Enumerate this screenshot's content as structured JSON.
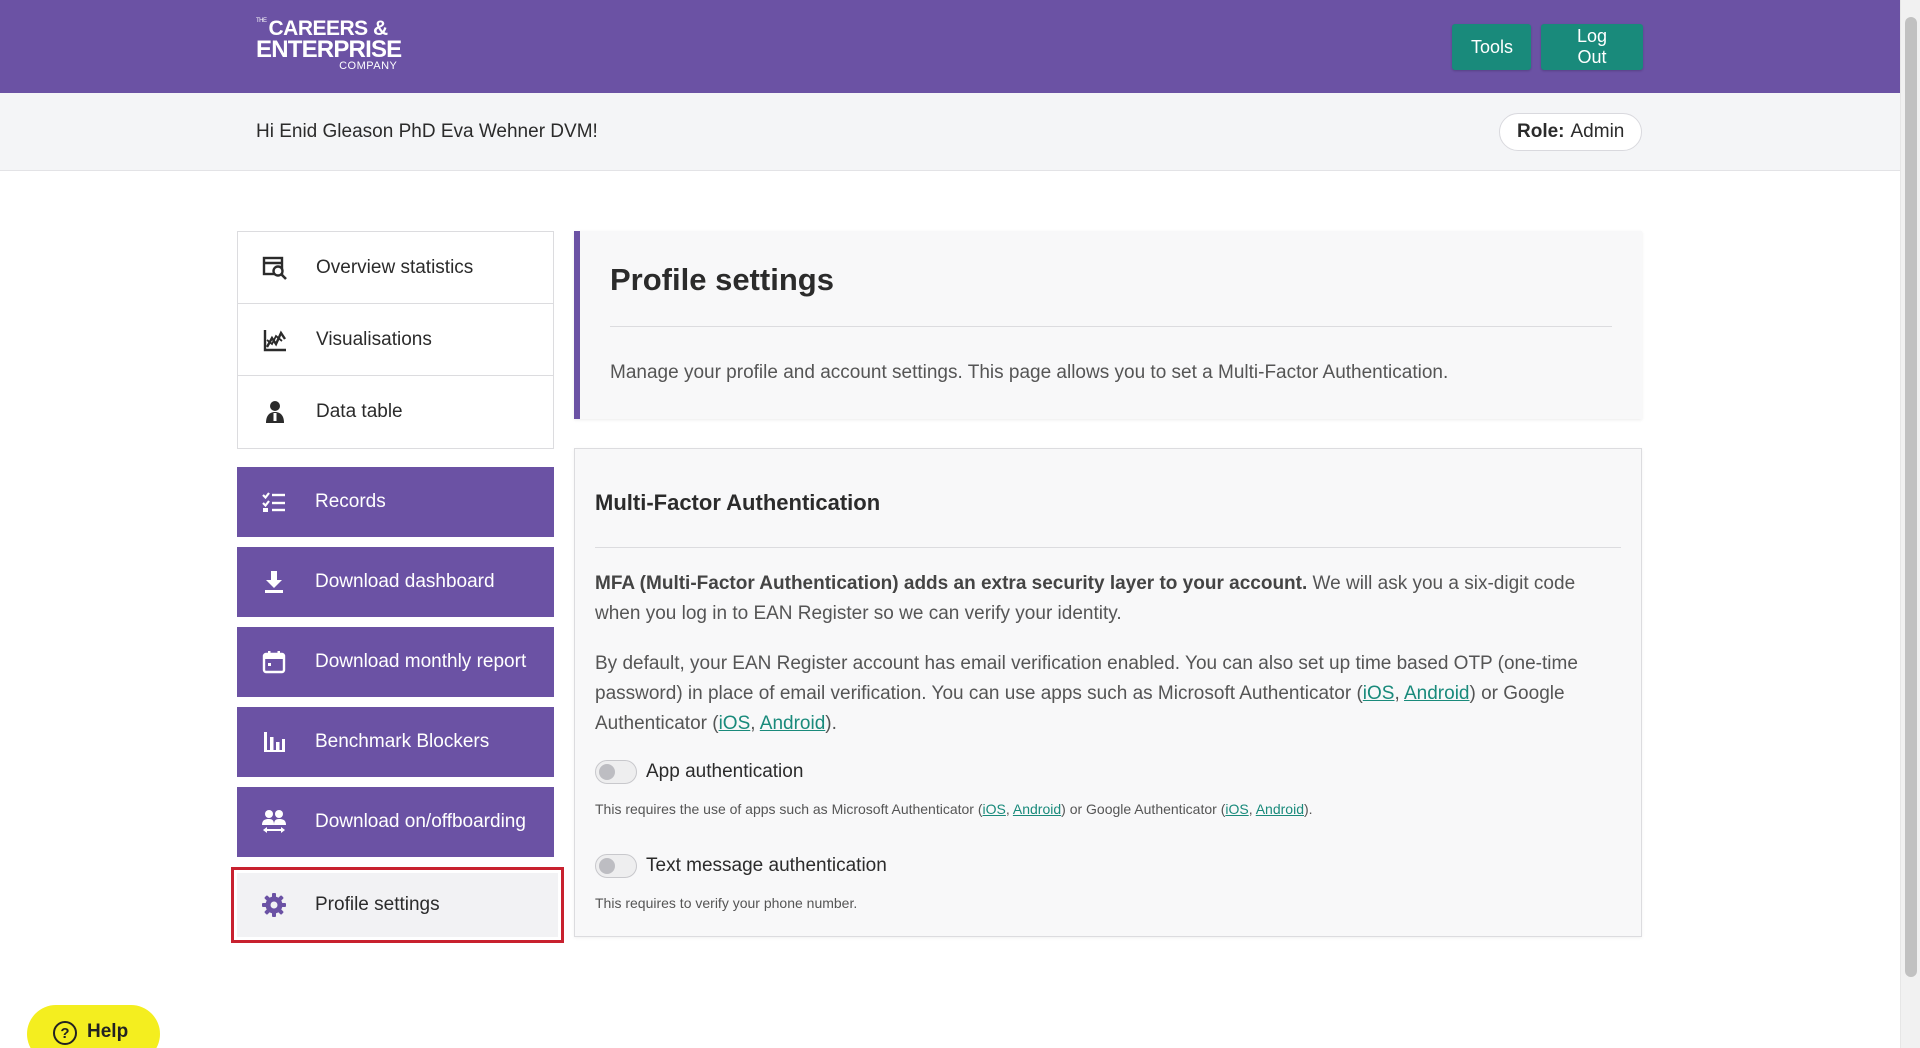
{
  "header": {
    "logo": {
      "line1_small": "THE",
      "line1": "CAREERS &",
      "line2": "ENTERPRISE",
      "line3": "COMPANY"
    },
    "tools_label": "Tools",
    "logout_label": "Log Out"
  },
  "greeting": {
    "text": "Hi Enid Gleason PhD Eva Wehner DVM!",
    "role_label": "Role:",
    "role_value": "Admin"
  },
  "sidebar": {
    "plain_items": [
      {
        "label": "Overview statistics",
        "icon": "search-chart-icon"
      },
      {
        "label": "Visualisations",
        "icon": "line-chart-icon"
      },
      {
        "label": "Data table",
        "icon": "person-icon"
      }
    ],
    "purple_items": [
      {
        "label": "Records",
        "icon": "checklist-icon"
      },
      {
        "label": "Download dashboard",
        "icon": "download-icon"
      },
      {
        "label": "Download monthly report",
        "icon": "calendar-icon"
      },
      {
        "label": "Benchmark Blockers",
        "icon": "bar-chart-icon"
      },
      {
        "label": "Download on/offboarding",
        "icon": "people-arrows-icon"
      }
    ],
    "active_item": {
      "label": "Profile settings",
      "icon": "gear-icon"
    },
    "colors": {
      "purple": "#6b52a4",
      "active_border": "#c8212f"
    }
  },
  "page": {
    "title": "Profile settings",
    "description": "Manage your profile and account settings. This page allows you to set a Multi-Factor Authentication."
  },
  "mfa": {
    "title": "Multi-Factor Authentication",
    "p1_bold": "MFA (Multi-Factor Authentication) adds an extra security layer to your account.",
    "p1_rest": " We will ask you a six-digit code when you log in to EAN Register so we can verify your identity.",
    "p2_a": "By default, your EAN Register account has email verification enabled. You can also set up time based OTP (one-time password) in place of email verification. You can use apps such as Microsoft Authenticator (",
    "p2_b": ") or Google Authenticator (",
    "p2_c": ").",
    "link_ios": "iOS",
    "link_android": "Android",
    "sep": ", ",
    "app_toggle": {
      "label": "App authentication",
      "enabled": false,
      "hint_a": "This requires the use of apps such as Microsoft Authenticator (",
      "hint_b": ") or Google Authenticator (",
      "hint_c": ")."
    },
    "sms_toggle": {
      "label": "Text message authentication",
      "enabled": false,
      "hint": "This requires to verify your phone number."
    },
    "link_color": "#198a7b"
  },
  "help": {
    "label": "Help"
  }
}
